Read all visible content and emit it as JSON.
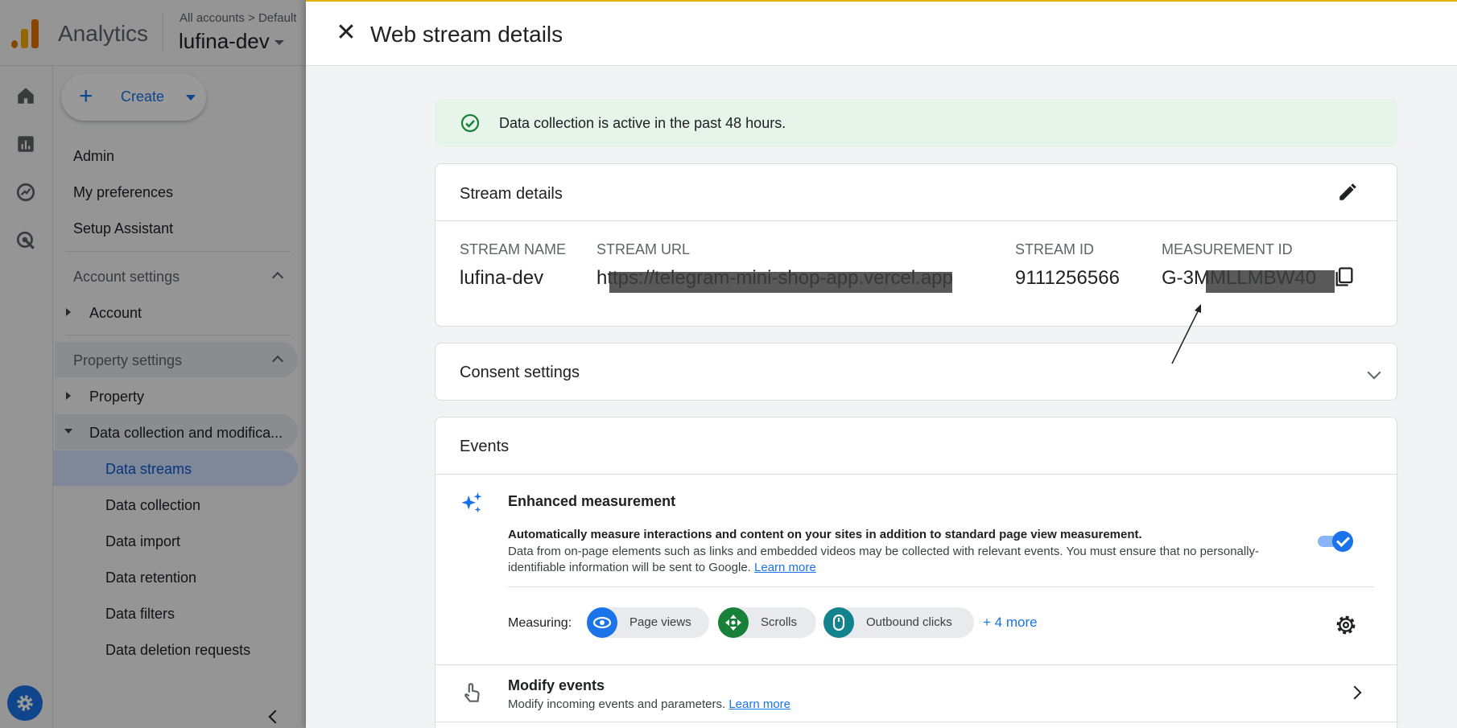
{
  "app": {
    "name": "Analytics",
    "breadcrumb": "All accounts > Default",
    "property": "lufina-dev"
  },
  "nav": {
    "create_label": "Create",
    "admin": "Admin",
    "my_preferences": "My preferences",
    "setup_assistant": "Setup Assistant",
    "account_settings": "Account settings",
    "account": "Account",
    "property_settings": "Property settings",
    "property": "Property",
    "data_collection_modification": "Data collection and modifica...",
    "data_streams": "Data streams",
    "data_collection": "Data collection",
    "data_import": "Data import",
    "data_retention": "Data retention",
    "data_filters": "Data filters",
    "data_deletion_requests": "Data deletion requests"
  },
  "panel": {
    "title": "Web stream details",
    "status_banner": "Data collection is active in the past 48 hours.",
    "stream_details": {
      "heading": "Stream details",
      "stream_name_label": "STREAM NAME",
      "stream_name": "lufina-dev",
      "stream_url_label": "STREAM URL",
      "stream_url": "https://telegram-mini-shop-app.vercel.app",
      "stream_id_label": "STREAM ID",
      "stream_id": "9111256566",
      "measurement_id_label": "MEASUREMENT ID",
      "measurement_id": "G-3MMLLMBW40"
    },
    "consent": {
      "heading": "Consent settings"
    },
    "events": {
      "heading": "Events",
      "enhanced_title": "Enhanced measurement",
      "enhanced_bold": "Automatically measure interactions and content on your sites in addition to standard page view measurement.",
      "enhanced_desc": "Data from on-page elements such as links and embedded videos may be collected with relevant events. You must ensure that no personally-identifiable information will be sent to Google.",
      "learn_more": "Learn more",
      "toggle_on": true,
      "measuring_label": "Measuring:",
      "chips": [
        "Page views",
        "Scrolls",
        "Outbound clicks"
      ],
      "more": "+ 4 more",
      "modify_title": "Modify events",
      "modify_desc": "Modify incoming events and parameters.",
      "modify_learn_more": "Learn more"
    }
  },
  "colors": {
    "accent": "#1a73e8",
    "success_bg": "#e6f4ea",
    "success": "#188038",
    "chip_pageviews": "#1a73e8",
    "chip_scrolls": "#188038",
    "chip_outbound": "#12828c"
  }
}
